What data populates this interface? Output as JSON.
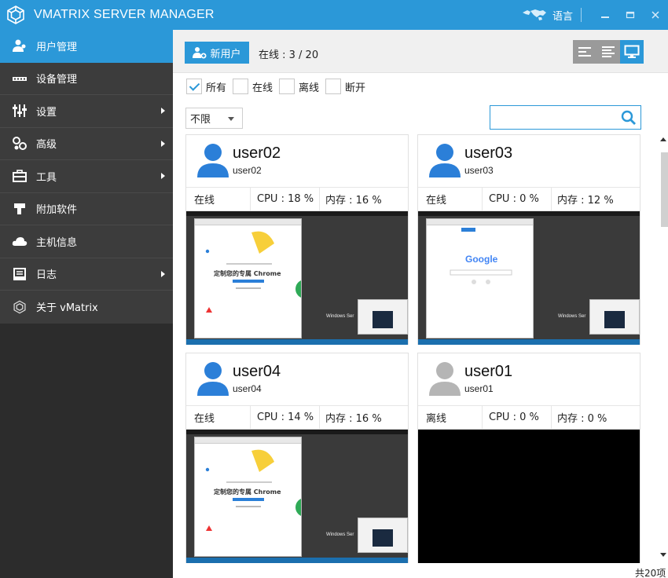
{
  "app": {
    "title": "VMATRIX SERVER MANAGER",
    "language_label": "语言",
    "minimize": "_",
    "maximize": "□",
    "close": "✕"
  },
  "sidebar": {
    "items": [
      {
        "label": "用户管理",
        "icon": "users-icon",
        "has_submenu": false,
        "active": true
      },
      {
        "label": "设备管理",
        "icon": "keyboard-icon",
        "has_submenu": false,
        "active": false
      },
      {
        "label": "设置",
        "icon": "sliders-icon",
        "has_submenu": true,
        "active": false
      },
      {
        "label": "高级",
        "icon": "gears-icon",
        "has_submenu": true,
        "active": false
      },
      {
        "label": "工具",
        "icon": "toolbox-icon",
        "has_submenu": true,
        "active": false
      },
      {
        "label": "附加软件",
        "icon": "plugin-icon",
        "has_submenu": false,
        "active": false
      },
      {
        "label": "主机信息",
        "icon": "cloud-icon",
        "has_submenu": false,
        "active": false
      },
      {
        "label": "日志",
        "icon": "log-icon",
        "has_submenu": true,
        "active": false
      },
      {
        "label": "关于 vMatrix",
        "icon": "vmatrix-logo-icon",
        "has_submenu": false,
        "active": false
      }
    ]
  },
  "toolbar": {
    "new_user_label": "新用户",
    "online_status": "在线 : 3 / 20"
  },
  "filters": {
    "options": [
      {
        "label": "所有",
        "checked": true
      },
      {
        "label": "在线",
        "checked": false
      },
      {
        "label": "离线",
        "checked": false
      },
      {
        "label": "断开",
        "checked": false
      }
    ],
    "limit_select": "不限",
    "search_placeholder": ""
  },
  "cards": [
    {
      "name": "user02",
      "sub": "user02",
      "status": "在线",
      "cpu": "CPU : 18 %",
      "mem": "内存 : 16 %",
      "online": true,
      "screen": "chrome"
    },
    {
      "name": "user03",
      "sub": "user03",
      "status": "在线",
      "cpu": "CPU : 0 %",
      "mem": "内存 : 12 %",
      "online": true,
      "screen": "google"
    },
    {
      "name": "user04",
      "sub": "user04",
      "status": "在线",
      "cpu": "CPU : 14 %",
      "mem": "内存 : 16 %",
      "online": true,
      "screen": "chrome"
    },
    {
      "name": "user01",
      "sub": "user01",
      "status": "离线",
      "cpu": "CPU : 0 %",
      "mem": "内存 : 0 %",
      "online": false,
      "screen": "none"
    }
  ],
  "screens": {
    "chrome_promo": "定制您的专属 Chrome",
    "google_logo": "Google",
    "windows_label": "Windows Ser"
  },
  "footer": {
    "total": "共20项"
  },
  "colors": {
    "accent": "#2b98d8",
    "sidebar_bg": "#3c3c3c",
    "online_avatar": "#2b7fd8",
    "offline_avatar": "#b5b5b5"
  }
}
